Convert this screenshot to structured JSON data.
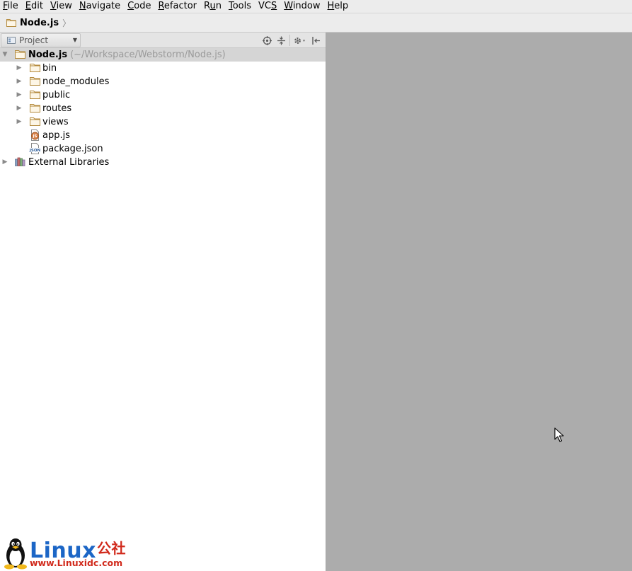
{
  "menu": [
    {
      "prefix": "",
      "mnemonic": "F",
      "rest": "ile"
    },
    {
      "prefix": "",
      "mnemonic": "E",
      "rest": "dit"
    },
    {
      "prefix": "",
      "mnemonic": "V",
      "rest": "iew"
    },
    {
      "prefix": "",
      "mnemonic": "N",
      "rest": "avigate"
    },
    {
      "prefix": "",
      "mnemonic": "C",
      "rest": "ode"
    },
    {
      "prefix": "",
      "mnemonic": "R",
      "rest": "efactor"
    },
    {
      "prefix": "R",
      "mnemonic": "u",
      "rest": "n"
    },
    {
      "prefix": "",
      "mnemonic": "T",
      "rest": "ools"
    },
    {
      "prefix": "VC",
      "mnemonic": "S",
      "rest": ""
    },
    {
      "prefix": "",
      "mnemonic": "W",
      "rest": "indow"
    },
    {
      "prefix": "",
      "mnemonic": "H",
      "rest": "elp"
    }
  ],
  "breadcrumb": {
    "label": "Node.js",
    "separator": "〉",
    "icon": "folder-icon"
  },
  "project_panel": {
    "view_label": "Project",
    "tools": [
      "locate-icon",
      "collapse-all-icon",
      "settings-icon",
      "hide-icon"
    ]
  },
  "tree": {
    "root": {
      "label": "Node.js",
      "path": "(~/Workspace/Webstorm/Node.js)",
      "icon": "folder-icon",
      "expanded": true
    },
    "children": [
      {
        "label": "bin",
        "icon": "folder-icon",
        "expandable": true
      },
      {
        "label": "node_modules",
        "icon": "folder-icon",
        "expandable": true
      },
      {
        "label": "public",
        "icon": "folder-icon",
        "expandable": true
      },
      {
        "label": "routes",
        "icon": "folder-icon",
        "expandable": true
      },
      {
        "label": "views",
        "icon": "folder-icon",
        "expandable": true
      },
      {
        "label": "app.js",
        "icon": "js-file-icon",
        "expandable": false
      },
      {
        "label": "package.json",
        "icon": "json-file-icon",
        "expandable": false
      }
    ],
    "external": {
      "label": "External Libraries",
      "icon": "library-icon"
    }
  },
  "watermark": {
    "brand": "Linux",
    "brand_cn": "公社",
    "url": "www.Linuxidc.com"
  },
  "colors": {
    "editor_bg": "#acacac",
    "folder": "#c8a15a",
    "selected_row": "#d5d5d5",
    "watermark_blue": "#1c66c6",
    "watermark_red": "#d12a1c"
  }
}
